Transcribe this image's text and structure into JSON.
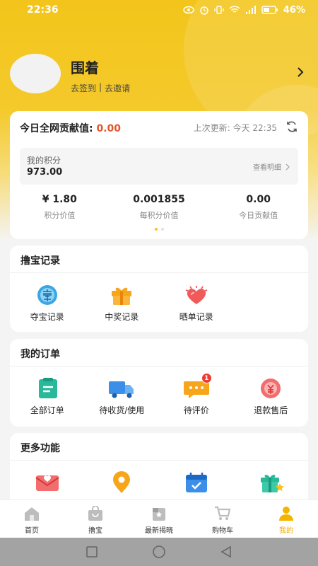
{
  "status": {
    "time": "22:36",
    "battery": "46%"
  },
  "profile": {
    "name": "围着",
    "checkin": "去签到",
    "separator": "|",
    "invite": "去邀请"
  },
  "contribution": {
    "label": "今日全网贡献值:",
    "value": "0.00",
    "last_update": "上次更新: 今天 22:35",
    "points_label": "我的积分",
    "points_value": "973.00",
    "detail_link": "查看明细",
    "stats": [
      {
        "value": "¥ 1.80",
        "label": "积分价值"
      },
      {
        "value": "0.001855",
        "label": "每积分价值"
      },
      {
        "value": "0.00",
        "label": "今日贡献值"
      }
    ],
    "page_dots": {
      "count": 2,
      "active": 0
    }
  },
  "treasure": {
    "title": "撸宝记录",
    "items": [
      {
        "label": "夺宝记录",
        "icon": "treasure-record-icon"
      },
      {
        "label": "中奖记录",
        "icon": "gift-icon"
      },
      {
        "label": "晒单记录",
        "icon": "heart-icon"
      }
    ]
  },
  "orders": {
    "title": "我的订单",
    "items": [
      {
        "label": "全部订单",
        "icon": "clipboard-icon"
      },
      {
        "label": "待收货/使用",
        "icon": "truck-icon"
      },
      {
        "label": "待评价",
        "icon": "comment-icon",
        "badge": "1"
      },
      {
        "label": "退款售后",
        "icon": "refund-icon"
      }
    ]
  },
  "more": {
    "title": "更多功能",
    "items": [
      {
        "icon": "mail-heart-icon"
      },
      {
        "icon": "location-icon"
      },
      {
        "icon": "calendar-icon"
      },
      {
        "icon": "gift-star-icon"
      }
    ]
  },
  "tabbar": [
    {
      "label": "首页",
      "icon": "home-icon"
    },
    {
      "label": "撸宝",
      "icon": "bag-icon"
    },
    {
      "label": "最新揭晓",
      "icon": "announce-icon"
    },
    {
      "label": "购物车",
      "icon": "cart-icon"
    },
    {
      "label": "我的",
      "icon": "user-icon",
      "active": true
    }
  ],
  "colors": {
    "brand_yellow": "#f4c31d",
    "accent_red": "#e2562c",
    "badge_red": "#ee3b2e",
    "active_tab": "#e9a800"
  }
}
